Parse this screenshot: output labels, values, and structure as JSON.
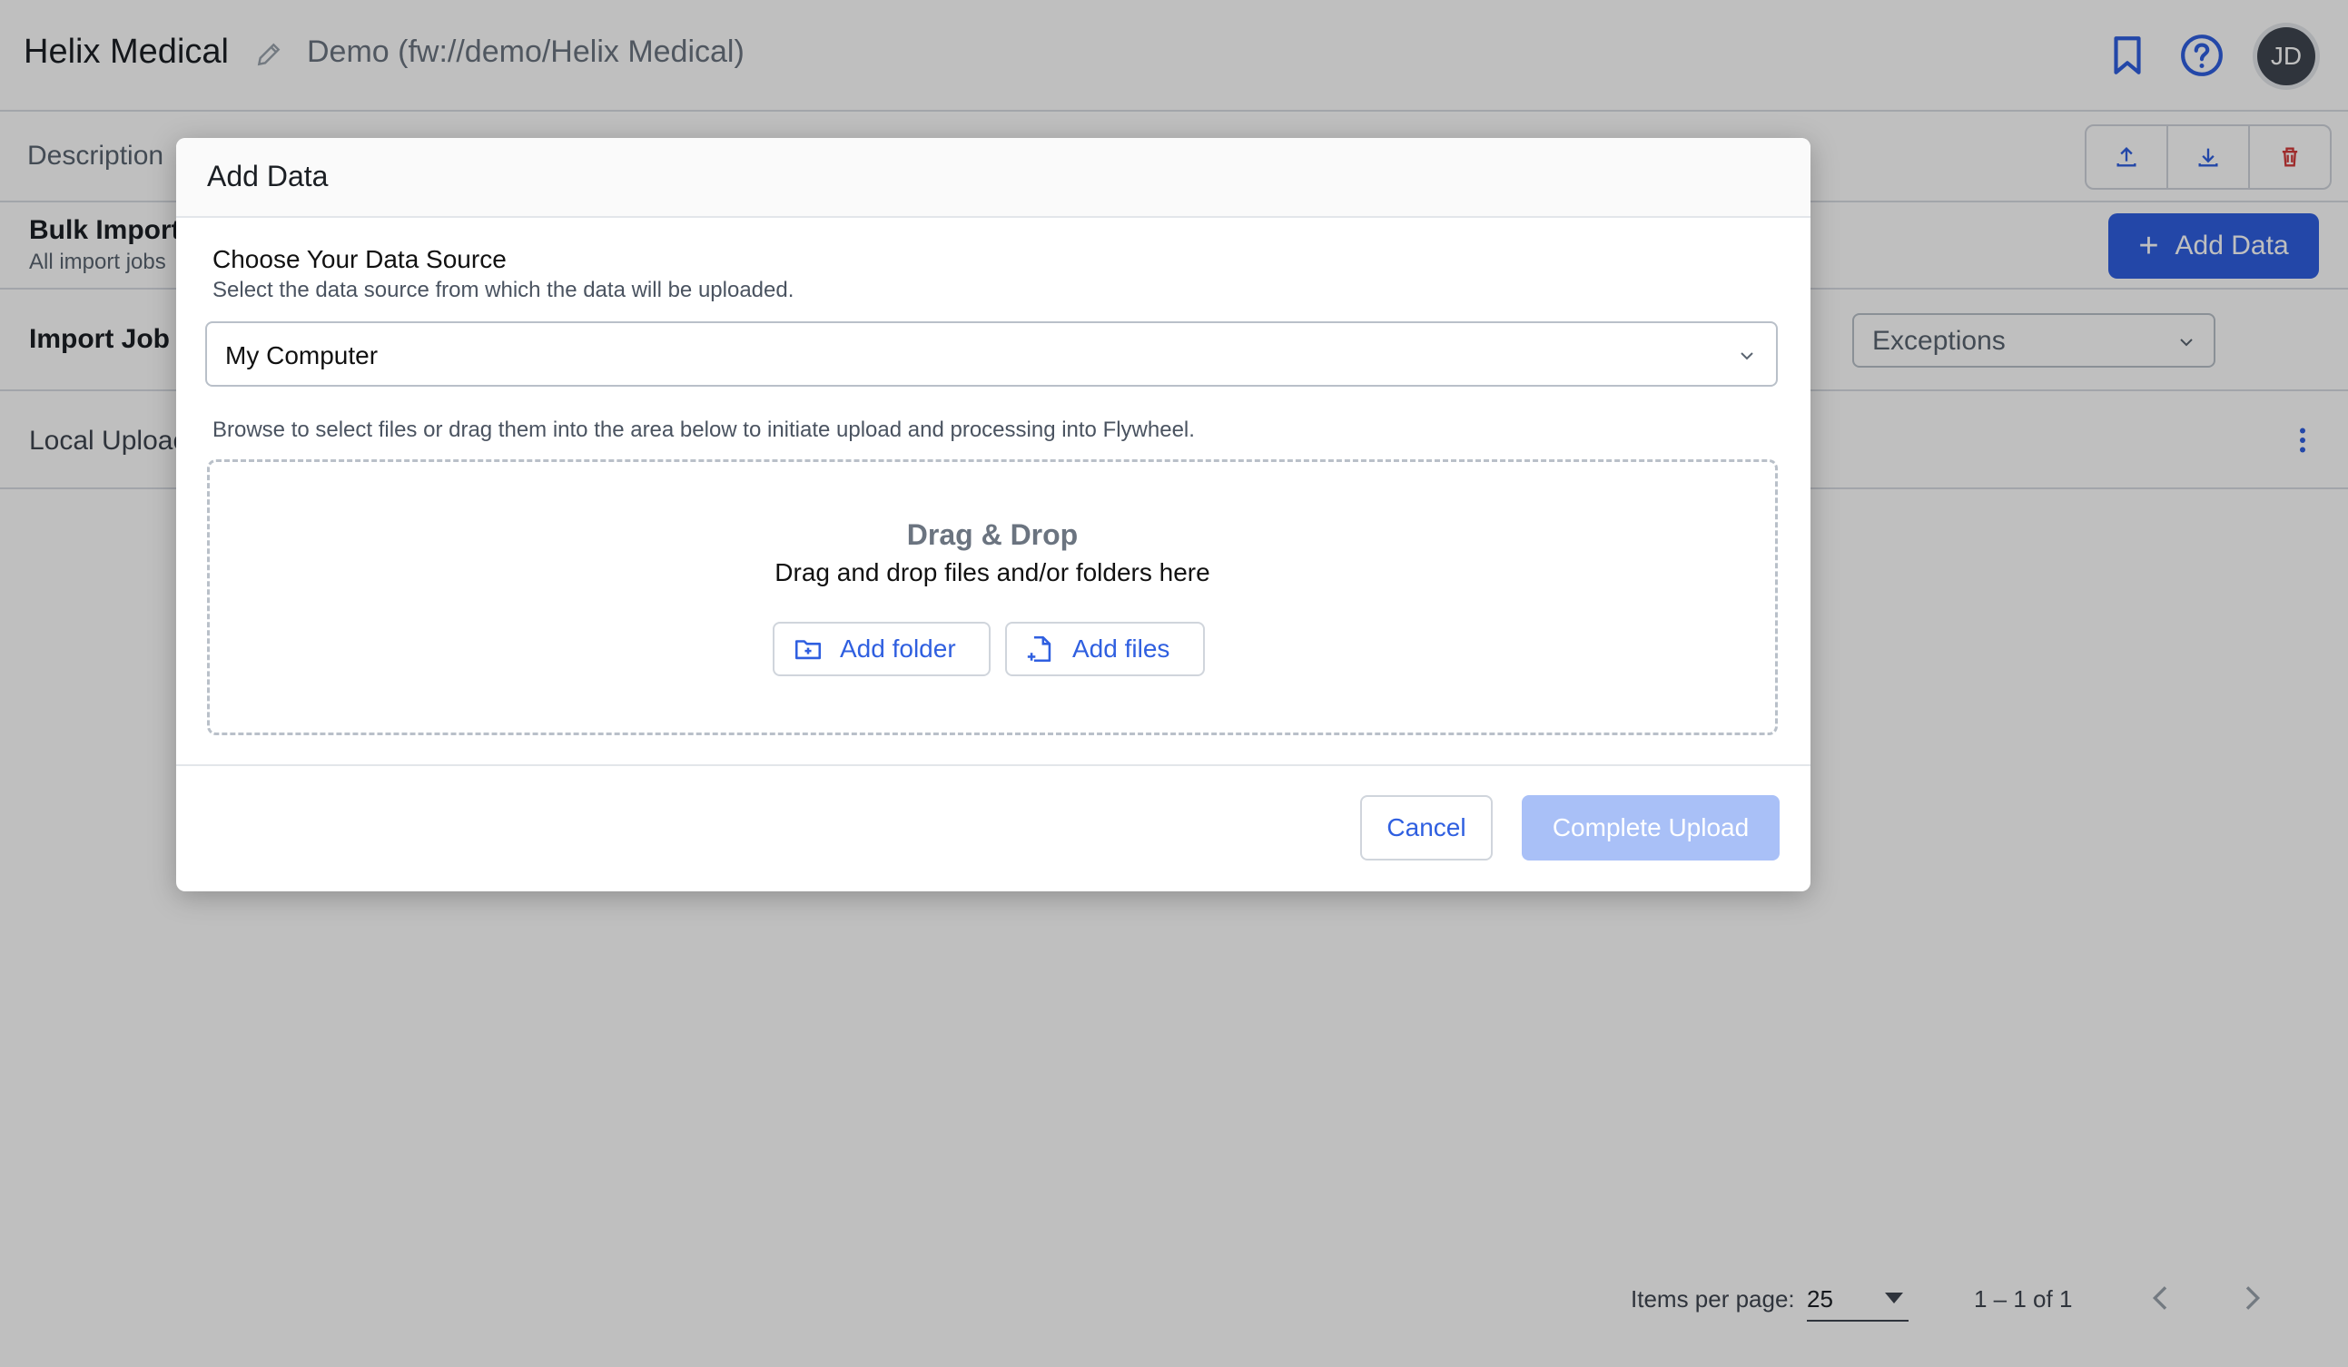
{
  "header": {
    "project_title": "Helix Medical",
    "project_path": "Demo (fw://demo/Helix Medical)",
    "avatar_initials": "JD",
    "icons": [
      "edit-icon",
      "bookmark-icon",
      "help-icon"
    ]
  },
  "tabs": {
    "description": "Description"
  },
  "bulk_import": {
    "title": "Bulk Import",
    "subtitle": "All import jobs",
    "add_data_label": "Add Data"
  },
  "filters": {
    "import_job_label": "Import Job N",
    "exceptions_value": "Exceptions"
  },
  "rows": {
    "local_upload": "Local Uploac"
  },
  "pagination": {
    "items_per_page_label": "Items per page:",
    "items_per_page_value": "25",
    "range": "1 – 1 of 1"
  },
  "modal": {
    "title": "Add Data",
    "section_title": "Choose Your Data Source",
    "section_subtitle": "Select the data source from which the data will be uploaded.",
    "source_value": "My Computer",
    "browse_text": "Browse to select files or drag them into the area below to initiate upload and processing into Flywheel.",
    "dropzone_title": "Drag & Drop",
    "dropzone_subtitle": "Drag and drop files and/or folders here",
    "add_folder_label": "Add folder",
    "add_files_label": "Add files",
    "cancel_label": "Cancel",
    "complete_label": "Complete Upload"
  },
  "colors": {
    "primary": "#2f5fe0",
    "primary_disabled": "#a9c0f7",
    "danger": "#d33a3a",
    "overlay": "rgba(0,0,0,0.25)"
  }
}
